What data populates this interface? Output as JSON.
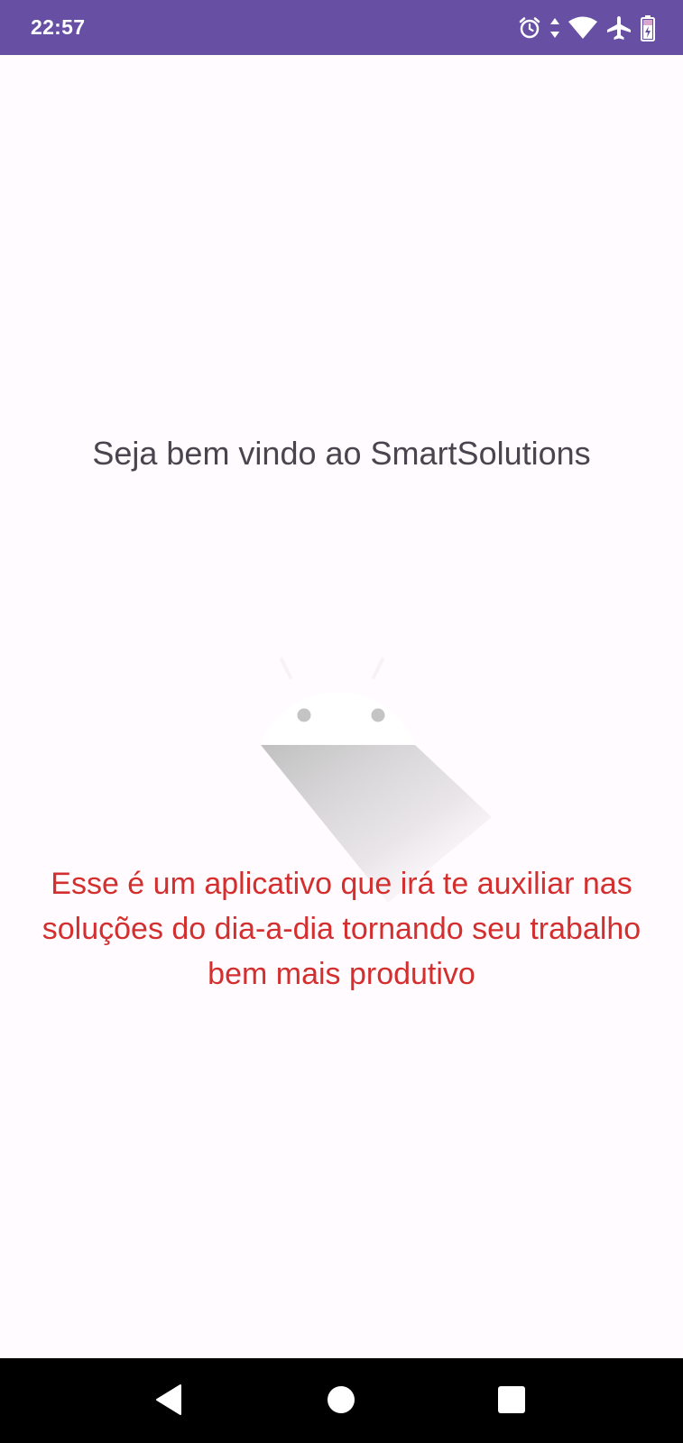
{
  "status_bar": {
    "time": "22:57",
    "background": "#6750a4",
    "icons": [
      "alarm-icon",
      "data-arrows-icon",
      "wifi-icon",
      "airplane-icon",
      "battery-icon"
    ]
  },
  "main": {
    "welcome_text": "Seja bem vindo ao SmartSolutions",
    "illustration": "android-placeholder-icon",
    "description_text": "Esse é um aplicativo que irá te auxiliar nas soluções do dia-a-dia tornando seu trabalho bem mais produtivo",
    "description_color": "#d32f2f"
  },
  "nav_bar": {
    "buttons": [
      "back-icon",
      "home-icon",
      "recents-icon"
    ]
  }
}
